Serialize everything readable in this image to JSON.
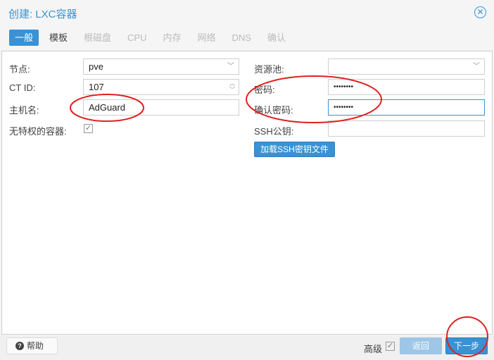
{
  "dialog": {
    "title": "创建: LXC容器",
    "close_icon": "close-circle-icon"
  },
  "tabs": [
    {
      "label": "一般",
      "state": "active"
    },
    {
      "label": "模板",
      "state": "enabled"
    },
    {
      "label": "根磁盘",
      "state": "disabled"
    },
    {
      "label": "CPU",
      "state": "disabled"
    },
    {
      "label": "内存",
      "state": "disabled"
    },
    {
      "label": "网络",
      "state": "disabled"
    },
    {
      "label": "DNS",
      "state": "disabled"
    },
    {
      "label": "确认",
      "state": "disabled"
    }
  ],
  "left": {
    "node_label": "节点:",
    "node_value": "pve",
    "ctid_label": "CT ID:",
    "ctid_value": "107",
    "hostname_label": "主机名:",
    "hostname_value": "AdGuard",
    "unprivileged_label": "无特权的容器:",
    "unprivileged_checked": true
  },
  "right": {
    "pool_label": "资源池:",
    "pool_value": "",
    "password_label": "密码:",
    "password_value": "••••••••",
    "confirm_label": "确认密码:",
    "confirm_value": "••••••••",
    "ssh_label": "SSH公钥:",
    "ssh_value": "",
    "load_ssh_button": "加载SSH密钥文件"
  },
  "footer": {
    "help": "帮助",
    "advanced": "高级",
    "advanced_checked": true,
    "back": "返回",
    "next": "下一步"
  },
  "colors": {
    "accent": "#3892d4",
    "annotation": "#e02020"
  }
}
